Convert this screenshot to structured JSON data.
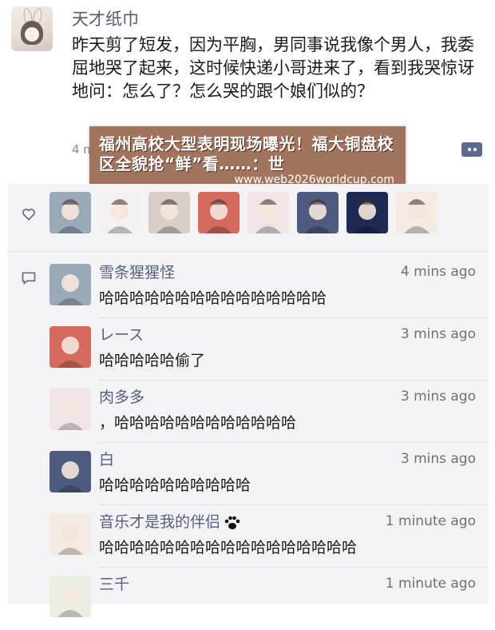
{
  "post": {
    "username": "天才纸巾",
    "text": "昨天剪了短发，因为平胸，男同事说我像个男人，我委屈地哭了起来，这时候快递小哥进来了，看到我哭惊讶地问：怎么了？怎么哭的跟个娘们似的？",
    "time": "4 m"
  },
  "banner": {
    "headline": "福州高校大型表明现场曝光！福大铜盘校区全貌抢“鲜”看……：世",
    "url": "www.web2026worldcup.com"
  },
  "likes": {
    "avatars": [
      {
        "icon": "avatar-santa-girl-icon",
        "bg": "#9aa9b8"
      },
      {
        "icon": "avatar-girl-santa-hat-icon",
        "bg": "#f4f1ee"
      },
      {
        "icon": "avatar-santa-hat-girl-icon",
        "bg": "#d9cfc8"
      },
      {
        "icon": "avatar-red-hair-girl-icon",
        "bg": "#d46b5e"
      },
      {
        "icon": "avatar-pink-bunny-icon",
        "bg": "#f1e4e4"
      },
      {
        "icon": "avatar-dark-anime-girl-icon",
        "bg": "#4e5b7e"
      },
      {
        "icon": "avatar-night-sky-icon",
        "bg": "#1f2a52"
      },
      {
        "icon": "avatar-cute-bear-icon",
        "bg": "#f4ece2"
      }
    ]
  },
  "comments": [
    {
      "name": "雪条猩猩怪",
      "time": "4 mins ago",
      "text": "哈哈哈哈哈哈哈哈哈哈哈哈哈哈哈",
      "avatar_bg": "#9aa9b8"
    },
    {
      "name": "レース",
      "time": "3 mins ago",
      "text": "哈哈哈哈哈偷了",
      "avatar_bg": "#d46b5e"
    },
    {
      "name": "肉多多",
      "time": "3 mins ago",
      "text": "，哈哈哈哈哈哈哈哈哈哈哈哈",
      "avatar_bg": "#f1e4e4"
    },
    {
      "name": "白",
      "time": "3 mins ago",
      "text": "哈哈哈哈哈哈哈哈哈哈",
      "avatar_bg": "#4e5b7e"
    },
    {
      "name": "音乐才是我的伴侣",
      "time": "1 minute ago",
      "text": "哈哈哈哈哈哈哈哈哈哈哈哈哈哈哈哈哈",
      "avatar_bg": "#f4ece2"
    },
    {
      "name": "三千",
      "time": "1 minute ago",
      "text": "",
      "avatar_bg": "#e8eee4"
    }
  ],
  "colors": {
    "link": "#556080",
    "banner": "#9a6850",
    "panel": "#f3f3f5"
  }
}
